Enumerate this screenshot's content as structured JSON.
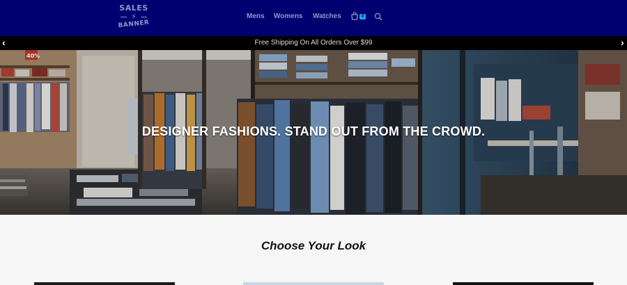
{
  "header": {
    "logo": {
      "line1": "SALES",
      "line2": "BANNER",
      "bolt": "⚡"
    },
    "nav": [
      {
        "label": "Mens"
      },
      {
        "label": "Womens"
      },
      {
        "label": "Watches"
      }
    ],
    "cart": {
      "icon": "shopping-bag-icon",
      "count": "0"
    },
    "search": {
      "icon": "search-icon"
    }
  },
  "banner": {
    "text": "Free Shipping On All Orders Over $99",
    "prev": "‹",
    "next": "›"
  },
  "hero": {
    "title": "DESIGNER FASHIONS. STAND OUT FROM THE CROWD.",
    "sign": "40%"
  },
  "section": {
    "title": "Choose Your Look"
  },
  "colors": {
    "header_bg": "#000070",
    "nav_text": "#8f97c6",
    "badge": "#1fa8e8",
    "banner_bg": "#000000",
    "page_bg": "#f6f6f6"
  }
}
